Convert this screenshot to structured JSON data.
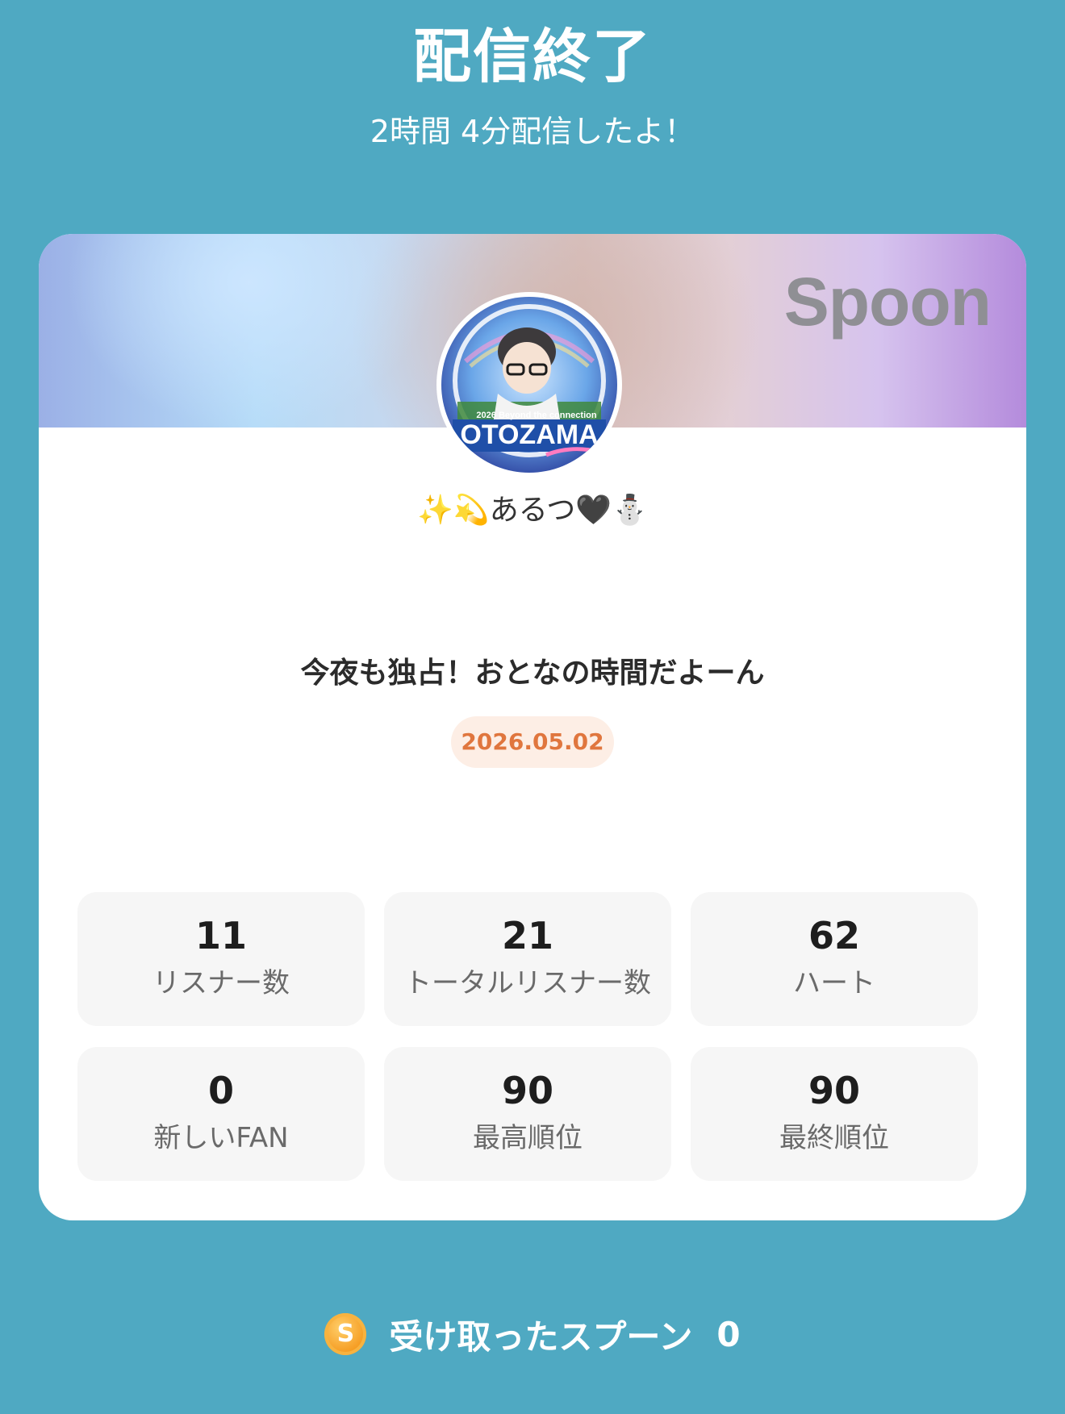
{
  "header": {
    "title": "配信終了",
    "subtitle": "2時間 4分配信したよ！"
  },
  "card": {
    "logo": "Spoon",
    "avatar_icon": "avatar-image",
    "username": "✨💫あるつ🖤⛄",
    "live_title": "今夜も独占！おとなの時間だよーん",
    "date": "2026.05.02",
    "date_color": "#e0763e"
  },
  "stats": [
    {
      "value": "11",
      "label": "リスナー数"
    },
    {
      "value": "21",
      "label": "トータルリスナー数"
    },
    {
      "value": "62",
      "label": "ハート"
    },
    {
      "value": "0",
      "label": "新しいFAN"
    },
    {
      "value": "90",
      "label": "最高順位"
    },
    {
      "value": "90",
      "label": "最終順位"
    }
  ],
  "footer": {
    "coin_icon": "spoon-coin-icon",
    "coin_letter": "S",
    "label": "受け取ったスプーン",
    "count": "0"
  },
  "colors": {
    "background": "#4fa9c2",
    "card": "#ffffff",
    "stat_tile": "#f6f6f6",
    "coin": "#f59a1f"
  }
}
